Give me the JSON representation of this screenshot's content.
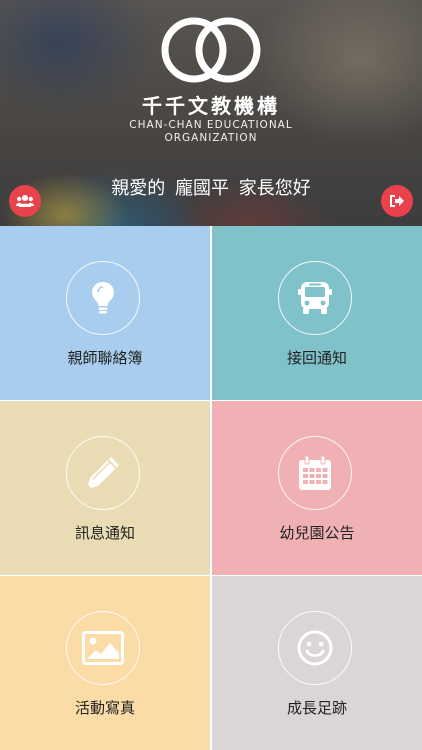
{
  "header": {
    "brand": "千千文教機構",
    "subtitle_line1": "CHAN-CHAN EDUCATIONAL",
    "subtitle_line2": "ORGANIZATION",
    "greeting_prefix": "親愛的",
    "greeting_name": "龐國平",
    "greeting_suffix": "家長您好",
    "left_button_icon": "users-icon",
    "right_button_icon": "logout-icon",
    "accent_color": "#e8424d"
  },
  "menu": [
    {
      "label": "親師聯絡簿",
      "icon": "lightbulb-icon",
      "color": "#a9cdee"
    },
    {
      "label": "接回通知",
      "icon": "bus-icon",
      "color": "#80c2c9"
    },
    {
      "label": "訊息通知",
      "icon": "pencil-icon",
      "color": "#e9dbb3"
    },
    {
      "label": "幼兒園公告",
      "icon": "calendar-icon",
      "color": "#efb1b3"
    },
    {
      "label": "活動寫真",
      "icon": "image-icon",
      "color": "#fbdba6"
    },
    {
      "label": "成長足跡",
      "icon": "smile-icon",
      "color": "#dbd5d8"
    }
  ]
}
